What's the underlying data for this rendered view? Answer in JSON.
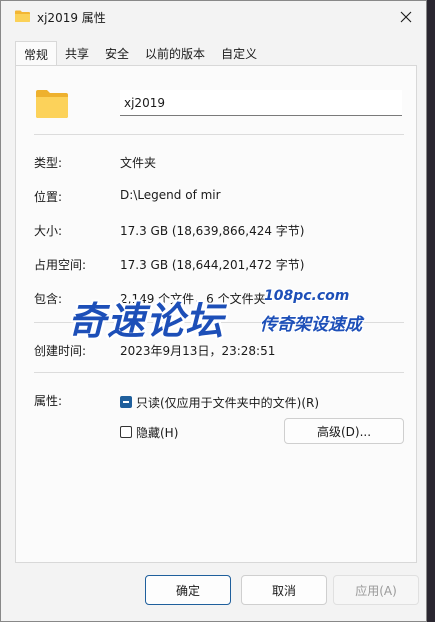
{
  "window": {
    "title": "xj2019 属性",
    "icon": "folder-icon"
  },
  "tabs": [
    {
      "label": "常规",
      "active": true
    },
    {
      "label": "共享"
    },
    {
      "label": "安全"
    },
    {
      "label": "以前的版本"
    },
    {
      "label": "自定义"
    }
  ],
  "general": {
    "name_value": "xj2019",
    "rows": [
      {
        "label": "类型:",
        "value": "文件夹"
      },
      {
        "label": "位置:",
        "value": "D:\\Legend of mir"
      },
      {
        "label": "大小:",
        "value": "17.3 GB (18,639,866,424 字节)"
      },
      {
        "label": "占用空间:",
        "value": "17.3 GB (18,644,201,472 字节)"
      },
      {
        "label": "包含:",
        "value": "2,149 个文件，6 个文件夹"
      },
      {
        "label": "创建时间:",
        "value": "2023年9月13日，23:28:51"
      }
    ],
    "attributes_label": "属性:",
    "readonly_label": "只读(仅应用于文件夹中的文件)(R)",
    "readonly_state": "indeterminate",
    "hidden_label": "隐藏(H)",
    "hidden_checked": false,
    "advanced_label": "高级(D)..."
  },
  "footer": {
    "ok": "确定",
    "cancel": "取消",
    "apply": "应用(A)"
  },
  "watermark": {
    "main": "奇速论坛",
    "url": "108pc.com",
    "sub": "传奇架设速成"
  },
  "colors": {
    "accent": "#1f5f9c",
    "folder": "#f8c73e",
    "watermark": "#1d4fb8"
  }
}
